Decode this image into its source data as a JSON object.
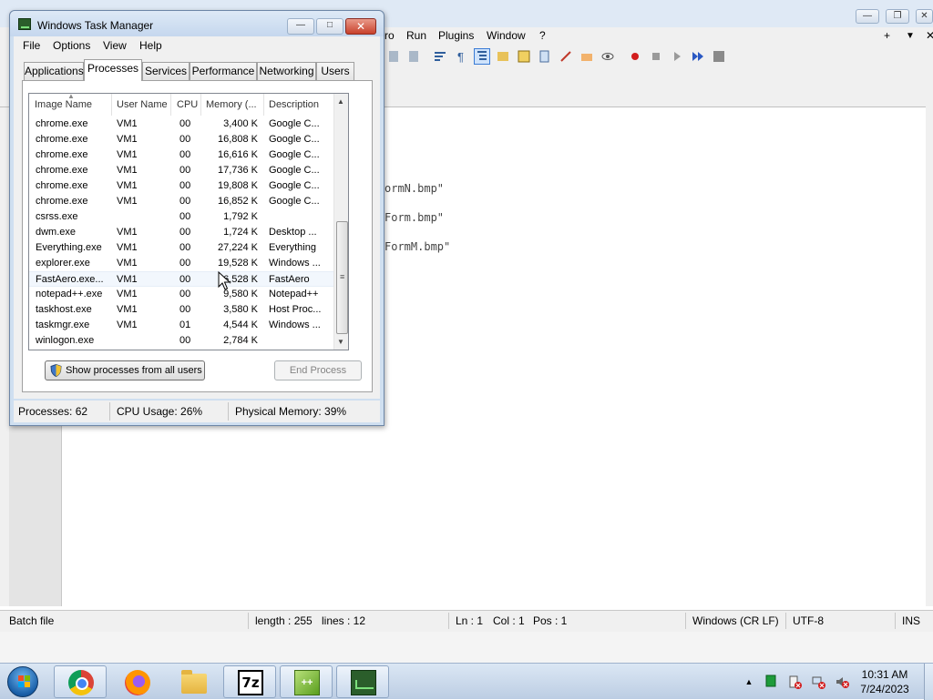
{
  "notepadpp": {
    "menu": [
      "ro",
      "Run",
      "Plugins",
      "Window",
      "?"
    ],
    "code_lines": [
      "ormN.bmp\"",
      "Form.bmp\"",
      "FormM.bmp\""
    ],
    "status": {
      "file_type": "Batch file",
      "length": "length : 255",
      "lines": "lines : 12",
      "ln": "Ln : 1",
      "col": "Col : 1",
      "pos": "Pos : 1",
      "eol": "Windows (CR LF)",
      "encoding": "UTF-8",
      "mode": "INS"
    }
  },
  "task_manager": {
    "title": "Windows Task Manager",
    "menu": [
      "File",
      "Options",
      "View",
      "Help"
    ],
    "tabs": [
      "Applications",
      "Processes",
      "Services",
      "Performance",
      "Networking",
      "Users"
    ],
    "active_tab": "Processes",
    "columns": [
      "Image Name",
      "User Name",
      "CPU",
      "Memory (...",
      "Description"
    ],
    "processes": [
      {
        "name": "chrome.exe",
        "user": "VM1",
        "cpu": "00",
        "memory": "3,400 K",
        "desc": "Google C..."
      },
      {
        "name": "chrome.exe",
        "user": "VM1",
        "cpu": "00",
        "memory": "16,808 K",
        "desc": "Google C..."
      },
      {
        "name": "chrome.exe",
        "user": "VM1",
        "cpu": "00",
        "memory": "16,616 K",
        "desc": "Google C..."
      },
      {
        "name": "chrome.exe",
        "user": "VM1",
        "cpu": "00",
        "memory": "17,736 K",
        "desc": "Google C..."
      },
      {
        "name": "chrome.exe",
        "user": "VM1",
        "cpu": "00",
        "memory": "19,808 K",
        "desc": "Google C..."
      },
      {
        "name": "chrome.exe",
        "user": "VM1",
        "cpu": "00",
        "memory": "16,852 K",
        "desc": "Google C..."
      },
      {
        "name": "csrss.exe",
        "user": "",
        "cpu": "00",
        "memory": "1,792 K",
        "desc": ""
      },
      {
        "name": "dwm.exe",
        "user": "VM1",
        "cpu": "00",
        "memory": "1,724 K",
        "desc": "Desktop ..."
      },
      {
        "name": "Everything.exe",
        "user": "VM1",
        "cpu": "00",
        "memory": "27,224 K",
        "desc": "Everything"
      },
      {
        "name": "explorer.exe",
        "user": "VM1",
        "cpu": "00",
        "memory": "19,528 K",
        "desc": "Windows ..."
      },
      {
        "name": "FastAero.exe...",
        "user": "VM1",
        "cpu": "00",
        "memory": "16,528 K",
        "desc": "FastAero"
      },
      {
        "name": "notepad++.exe",
        "user": "VM1",
        "cpu": "00",
        "memory": "9,580 K",
        "desc": "Notepad++"
      },
      {
        "name": "taskhost.exe",
        "user": "VM1",
        "cpu": "00",
        "memory": "3,580 K",
        "desc": "Host Proc..."
      },
      {
        "name": "taskmgr.exe",
        "user": "VM1",
        "cpu": "01",
        "memory": "4,544 K",
        "desc": "Windows ..."
      },
      {
        "name": "winlogon.exe",
        "user": "",
        "cpu": "00",
        "memory": "2,784 K",
        "desc": ""
      }
    ],
    "selected_process": "FastAero.exe...",
    "buttons": {
      "show_all": "Show processes from all users",
      "end_process": "End Process"
    },
    "status": {
      "processes": "Processes: 62",
      "cpu": "CPU Usage: 26%",
      "memory": "Physical Memory: 39%"
    }
  },
  "taskbar": {
    "apps": [
      "chrome-icon",
      "firefox-icon",
      "folder-icon",
      "7zip-icon",
      "notepadpp-icon",
      "task-manager-icon"
    ],
    "sevenzip_label": "7z",
    "time": "10:31 AM",
    "date": "7/24/2023"
  },
  "colors": {
    "accent": "#3a7bd5",
    "titlebar": "#cfdff0",
    "close": "#c8412b"
  }
}
